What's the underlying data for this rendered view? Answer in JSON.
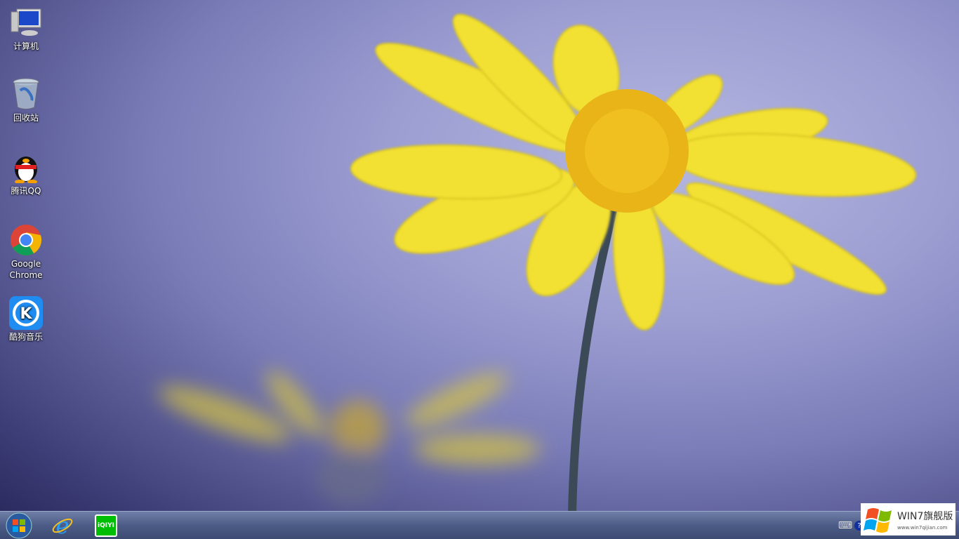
{
  "desktop": {
    "icons": [
      {
        "label": "计算机",
        "icon": "computer-icon"
      },
      {
        "label": "回收站",
        "icon": "recycle-bin-icon"
      },
      {
        "label": "腾讯QQ",
        "icon": "qq-penguin-icon"
      },
      {
        "label": "Google Chrome",
        "icon": "chrome-icon"
      },
      {
        "label": "酷狗音乐",
        "icon": "kugou-icon"
      }
    ]
  },
  "taskbar": {
    "pinned": [
      "start-orb-icon",
      "internet-explorer-icon",
      "iqiyi-icon"
    ],
    "iqiyi_text": "iQIYI",
    "tray": [
      "keyboard-icon",
      "help-icon"
    ]
  },
  "watermark": {
    "title": "WIN7旗舰版",
    "url": "www.win7qijian.com"
  },
  "colors": {
    "petal": "#f2e030",
    "taskbar": "#4c5c86"
  }
}
